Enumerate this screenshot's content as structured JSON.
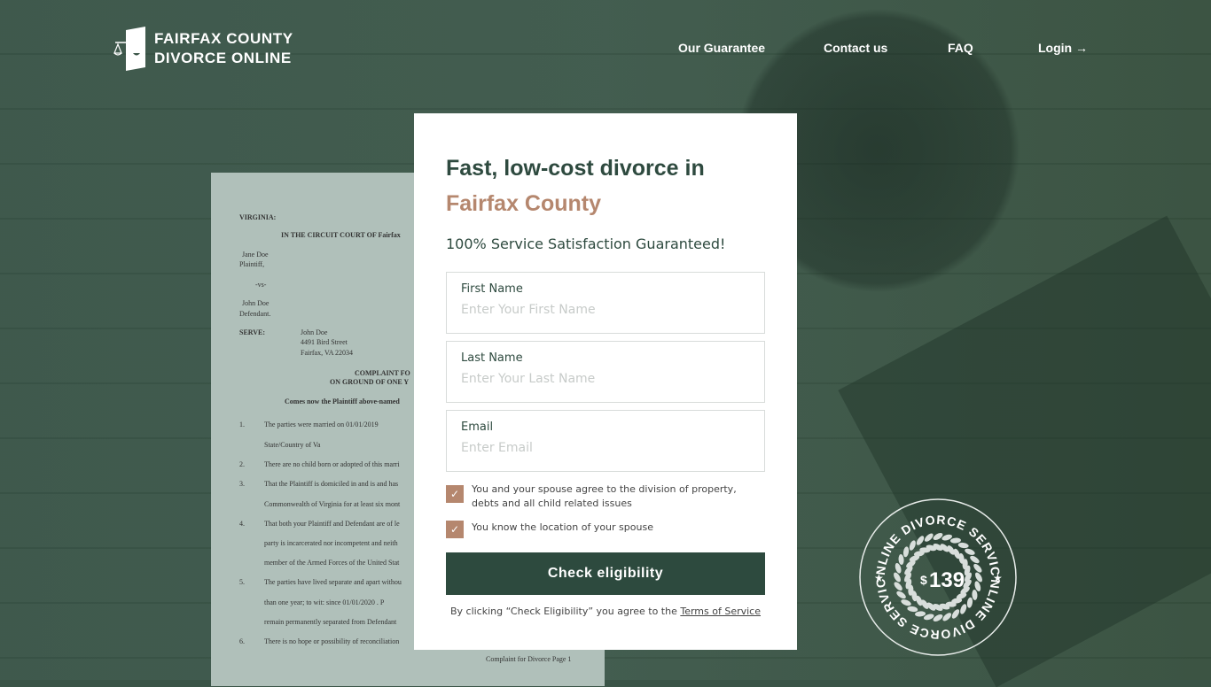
{
  "brand": {
    "line1": "FAIRFAX COUNTY",
    "line2": "DIVORCE ONLINE"
  },
  "nav": [
    {
      "label": "Our Guarantee"
    },
    {
      "label": "Contact us"
    },
    {
      "label": "FAQ"
    },
    {
      "label": "Login"
    }
  ],
  "document": {
    "lines": [
      "VIRGINIA:",
      "IN THE CIRCUIT COURT OF  Fairfax",
      "Jane Doe",
      "Plaintiff,",
      "-vs-",
      "John Doe",
      "Defendant.",
      "SERVE:",
      "John Doe",
      "4491 Bird Street",
      "Fairfax, VA 22034",
      "COMPLAINT FO",
      "ON GROUND OF ONE Y",
      "Comes now the Plaintiff above-named",
      "The parties were married on   01/01/2019",
      "State/Country of   Va",
      "There are no child born or adopted of this marri",
      "That the Plaintiff is domiciled in and is and has",
      "Commonwealth of Virginia for at least six mont",
      "That both your Plaintiff and Defendant are of le",
      "party is incarcerated nor incompetent and neith",
      "member of the Armed Forces of the United Stat",
      "The parties have lived separate and apart withou",
      "than one year; to wit: since   01/01/2020   . P",
      "remain permanently separated from Defendant",
      "There is no hope or possibility of reconciliation",
      "Complaint for Divorce Page 1"
    ],
    "numbers": [
      "1.",
      "2.",
      "3.",
      "4.",
      "5.",
      "6."
    ]
  },
  "form": {
    "title_line1": "Fast, low-cost divorce in",
    "title_line2": "Fairfax County",
    "subtitle": "100% Service Satisfaction Guaranteed!",
    "fields": [
      {
        "label": "First Name",
        "placeholder": "Enter Your First Name",
        "value": ""
      },
      {
        "label": "Last Name",
        "placeholder": "Enter Your Last Name",
        "value": ""
      },
      {
        "label": "Email",
        "placeholder": "Enter Email",
        "value": ""
      }
    ],
    "checks": [
      {
        "label": "You and your spouse agree to the division of property, debts and all child related issues",
        "checked": true
      },
      {
        "label": "You know the location of your spouse",
        "checked": true
      }
    ],
    "button": "Check eligibility",
    "terms_prefix": "By clicking “Check Eligibility” you agree to the ",
    "terms_link": "Terms of Service"
  },
  "badge": {
    "text": "ONLINE DIVORCE SERVICE",
    "currency": "$",
    "price": "139"
  },
  "colors": {
    "background": "#3a5447",
    "primary": "#2d4a3e",
    "accent": "#b5876e"
  }
}
